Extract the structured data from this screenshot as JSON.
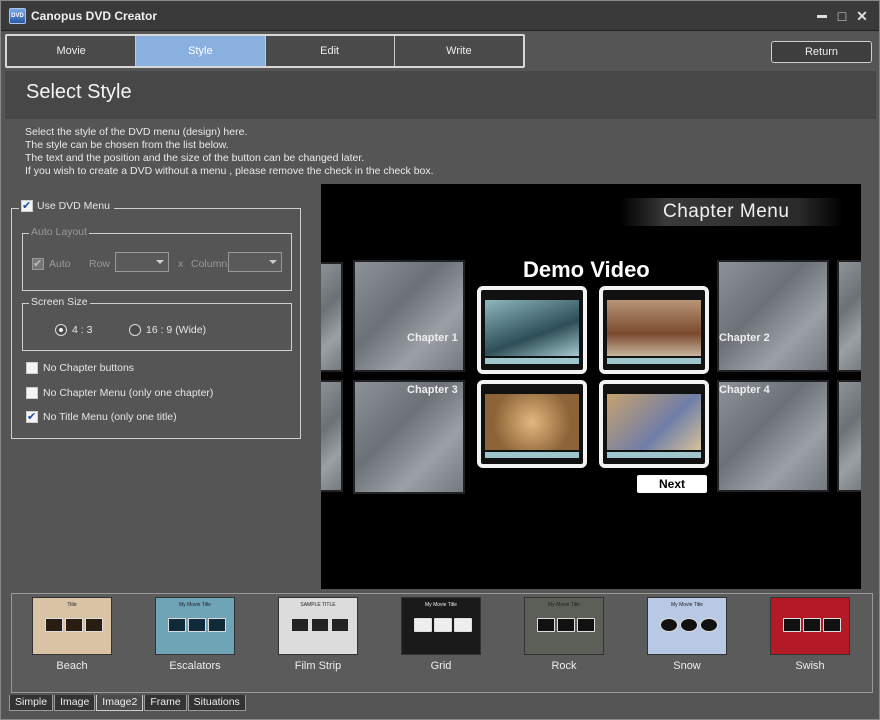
{
  "app": {
    "title": "Canopus DVD Creator",
    "icon_text": "DVD"
  },
  "window_controls": {
    "minimize": "▬",
    "maximize": "□",
    "close": "✕"
  },
  "tabs": [
    {
      "label": "Movie",
      "active": false
    },
    {
      "label": "Style",
      "active": true
    },
    {
      "label": "Edit",
      "active": false
    },
    {
      "label": "Write",
      "active": false
    }
  ],
  "return_label": "Return",
  "page_title": "Select Style",
  "description": [
    "Select the style of the DVD menu (design) here.",
    "The style can be chosen from the list below.",
    "The text and the position and the size of the button can be changed later.",
    "If you wish to create a DVD without a menu , please remove the check in the check box."
  ],
  "options": {
    "use_dvd_menu": {
      "label": "Use DVD Menu",
      "checked": true
    },
    "auto_layout": {
      "legend": "Auto Layout",
      "auto_label": "Auto",
      "auto_checked": true,
      "row_label": "Row",
      "x_label": "x",
      "column_label": "Column",
      "row_value": "",
      "column_value": ""
    },
    "screen_size": {
      "legend": "Screen Size",
      "opt_43": "4 : 3",
      "opt_169": "16 : 9 (Wide)",
      "selected": "4:3"
    },
    "no_chapter_buttons": {
      "label": "No Chapter buttons",
      "checked": false
    },
    "no_chapter_menu": {
      "label": "No Chapter Menu (only one chapter)",
      "checked": false
    },
    "no_title_menu": {
      "label": "No Title Menu (only one title)",
      "checked": true
    }
  },
  "preview": {
    "menu_title": "Chapter Menu",
    "video_title": "Demo Video",
    "chapters": [
      "Chapter 1",
      "Chapter 2",
      "Chapter 3",
      "Chapter 4"
    ],
    "next_label": "Next"
  },
  "styles": [
    {
      "name": "Beach",
      "bg": "#d8c3a4",
      "accent": "#2a1d12",
      "caption": "Title"
    },
    {
      "name": "Escalators",
      "bg": "#6fa3b6",
      "accent": "#0f2b3a",
      "caption": "My Movie Title"
    },
    {
      "name": "Film Strip",
      "bg": "#dcdcdc",
      "accent": "#222222",
      "caption": "SAMPLE TITLE"
    },
    {
      "name": "Grid",
      "bg": "#1a1a1a",
      "accent": "#eeeeee",
      "caption": "My Movie Title"
    },
    {
      "name": "Rock",
      "bg": "#5c5f58",
      "accent": "#111111",
      "caption": "My Movie Title"
    },
    {
      "name": "Snow",
      "bg": "#b7c9e4",
      "accent": "#111111",
      "caption": "My Movie Title"
    },
    {
      "name": "Swish",
      "bg": "#b41a26",
      "accent": "#111111",
      "caption": ""
    }
  ],
  "style_categories": [
    {
      "label": "Simple",
      "active": false
    },
    {
      "label": "Image",
      "active": false
    },
    {
      "label": "Image2",
      "active": true
    },
    {
      "label": "Frame",
      "active": false
    },
    {
      "label": "Situations",
      "active": false
    }
  ]
}
